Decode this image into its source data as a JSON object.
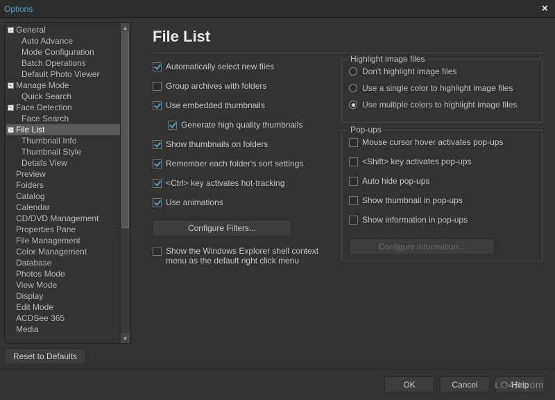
{
  "window": {
    "title": "Options",
    "close": "×"
  },
  "sidebar": {
    "reset_btn": "Reset to Defaults",
    "items": [
      {
        "label": "General",
        "level": 0,
        "exp": "-"
      },
      {
        "label": "Auto Advance",
        "level": 1
      },
      {
        "label": "Mode Configuration",
        "level": 1
      },
      {
        "label": "Batch Operations",
        "level": 1
      },
      {
        "label": "Default Photo Viewer",
        "level": 1
      },
      {
        "label": "Manage Mode",
        "level": 0,
        "exp": "-"
      },
      {
        "label": "Quick Search",
        "level": 1
      },
      {
        "label": "Face Detection",
        "level": 0,
        "exp": "-"
      },
      {
        "label": "Face Search",
        "level": 1
      },
      {
        "label": "File List",
        "level": 0,
        "exp": "-",
        "selected": true
      },
      {
        "label": "Thumbnail Info",
        "level": 1
      },
      {
        "label": "Thumbnail Style",
        "level": 1
      },
      {
        "label": "Details View",
        "level": 1
      },
      {
        "label": "Preview",
        "level": 0,
        "leaf": true
      },
      {
        "label": "Folders",
        "level": 0,
        "leaf": true
      },
      {
        "label": "Catalog",
        "level": 0,
        "leaf": true
      },
      {
        "label": "Calendar",
        "level": 0,
        "leaf": true
      },
      {
        "label": "CD/DVD Management",
        "level": 0,
        "leaf": true
      },
      {
        "label": "Properties Pane",
        "level": 0,
        "leaf": true
      },
      {
        "label": "File Management",
        "level": 0,
        "leaf": true
      },
      {
        "label": "Color Management",
        "level": 0,
        "leaf": true
      },
      {
        "label": "Database",
        "level": 0,
        "leaf": true
      },
      {
        "label": "Photos Mode",
        "level": 0,
        "leaf": true
      },
      {
        "label": "View Mode",
        "level": 0,
        "leaf": true
      },
      {
        "label": "Display",
        "level": 0,
        "leaf": true
      },
      {
        "label": "Edit Mode",
        "level": 0,
        "leaf": true
      },
      {
        "label": "ACDSee 365",
        "level": 0,
        "leaf": true
      },
      {
        "label": "Media",
        "level": 0,
        "leaf": true
      }
    ]
  },
  "main": {
    "heading": "File List",
    "left_checks": [
      {
        "label": "Automatically select new files",
        "checked": true
      },
      {
        "label": "Group archives with folders",
        "checked": false
      },
      {
        "label": "Use embedded thumbnails",
        "checked": true
      },
      {
        "label": "Generate high quality thumbnails",
        "checked": true,
        "sub": true
      },
      {
        "label": "Show thumbnails on folders",
        "checked": true
      },
      {
        "label": "Remember each folder's sort settings",
        "checked": true
      },
      {
        "label": "<Ctrl> key activates hot-tracking",
        "checked": true
      },
      {
        "label": "Use animations",
        "checked": true
      }
    ],
    "configure_filters": "Configure Filters...",
    "shell_check": {
      "label": "Show the Windows Explorer shell context menu as the default right click menu",
      "checked": false
    },
    "highlight": {
      "legend": "Highlight image files",
      "options": [
        {
          "label": "Don't highlight image files",
          "on": false
        },
        {
          "label": "Use a single color to highlight image files",
          "on": false
        },
        {
          "label": "Use multiple colors to highlight image files",
          "on": true
        }
      ]
    },
    "popups": {
      "legend": "Pop-ups",
      "checks": [
        {
          "label": "Mouse cursor hover activates pop-ups",
          "checked": false
        },
        {
          "label": "<Shift> key activates pop-ups",
          "checked": false
        },
        {
          "label": "Auto hide pop-ups",
          "checked": false
        },
        {
          "label": "Show thumbnail in pop-ups",
          "checked": false
        },
        {
          "label": "Show information in pop-ups",
          "checked": false
        }
      ],
      "config_btn": "Configure information..."
    }
  },
  "footer": {
    "ok": "OK",
    "cancel": "Cancel",
    "help": "Help"
  },
  "watermark": "LO4D.com"
}
